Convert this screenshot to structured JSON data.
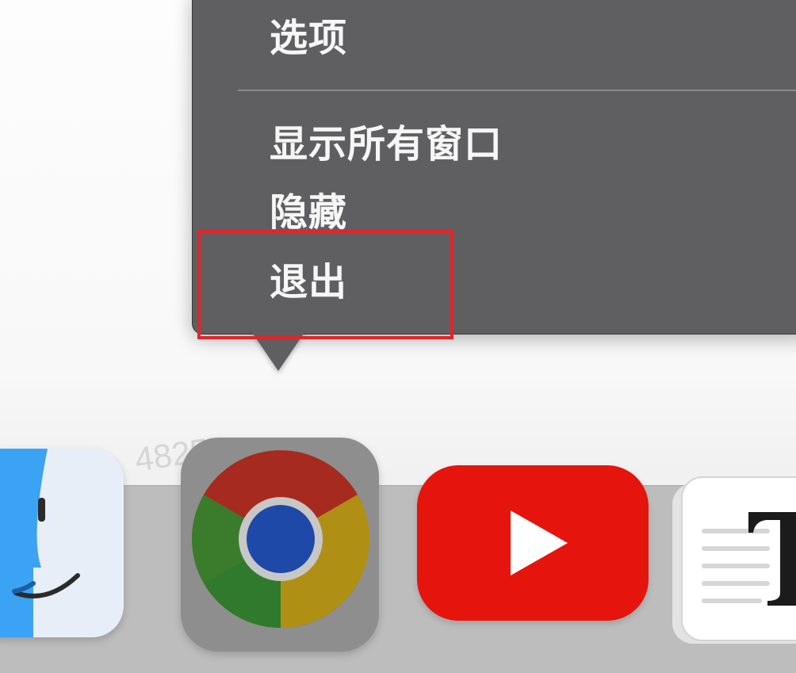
{
  "context_menu": {
    "items": [
      {
        "label": "选项"
      },
      {
        "label": "显示所有窗口"
      },
      {
        "label": "隐藏"
      },
      {
        "label": "退出"
      }
    ],
    "highlighted_item": "退出"
  },
  "watermark": {
    "text": "4825"
  },
  "dock": {
    "apps": [
      {
        "name": "Finder",
        "icon": "finder-icon"
      },
      {
        "name": "Google Chrome",
        "icon": "chrome-icon",
        "active": true
      },
      {
        "name": "YouTube",
        "icon": "youtube-icon"
      },
      {
        "name": "Typora",
        "icon": "typora-icon"
      }
    ]
  },
  "colors": {
    "menu_bg": "#5f5f61",
    "highlight": "#e0262b",
    "youtube_red": "#e5140d",
    "dock_bg": "#bdbdbd"
  }
}
